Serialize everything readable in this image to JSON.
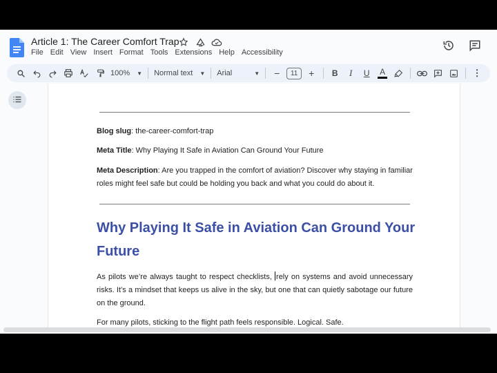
{
  "document": {
    "title": "Article 1: The Career Comfort Trap"
  },
  "menu": [
    "File",
    "Edit",
    "View",
    "Insert",
    "Format",
    "Tools",
    "Extensions",
    "Help",
    "Accessibility"
  ],
  "toolbar": {
    "zoom": "100%",
    "style": "Normal text",
    "font": "Arial",
    "font_size": "11"
  },
  "content": {
    "slug_label": "Blog slug",
    "slug_value": ": the-career-comfort-trap",
    "meta_title_label": "Meta Title",
    "meta_title_value": ": Why Playing It Safe in Aviation Can Ground Your Future",
    "meta_desc_label": "Meta Description",
    "meta_desc_value": ": Are you trapped in the comfort of aviation? Discover why staying in familiar roles might feel safe but could be holding you back and what you could do about it.",
    "heading": "Why Playing It Safe in Aviation Can Ground Your Future",
    "para1_before": "As pilots we’re always taught to respect checklists, ",
    "para1_after": "rely on systems and avoid unnecessary risks. It’s a mindset that keeps us alive in the sky, but one that can quietly sabotage our future on the ground.",
    "para2": "For many pilots, sticking to the flight path feels responsible. Logical. Safe."
  },
  "colors": {
    "heading": "#3c4fa6",
    "doc_blue": "#4285f4"
  }
}
